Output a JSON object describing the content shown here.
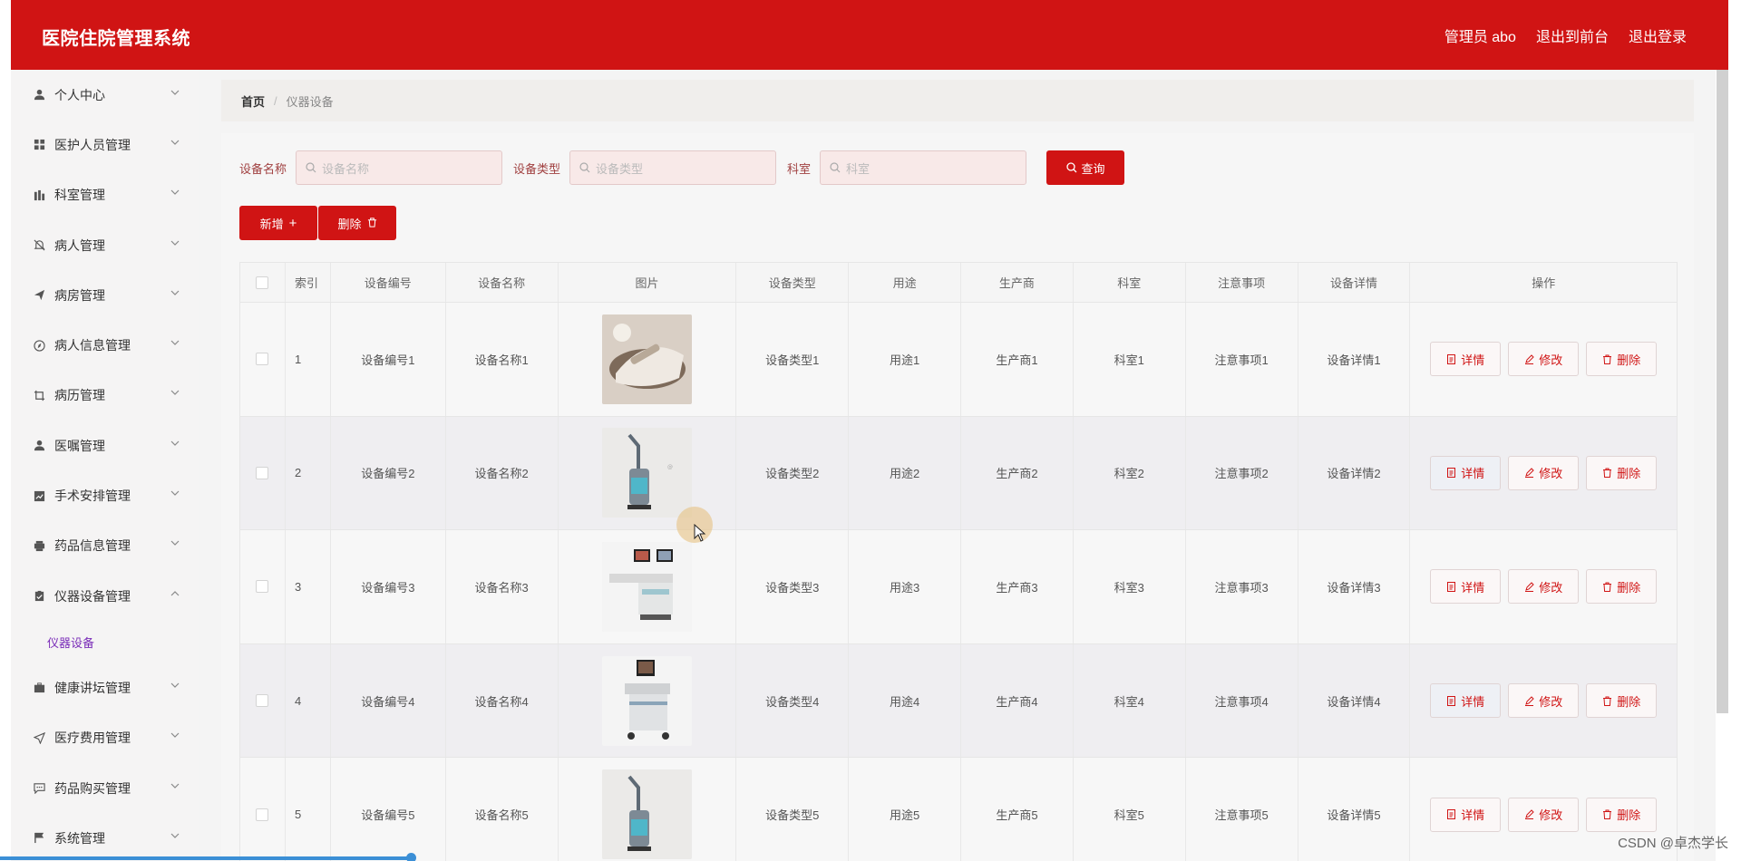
{
  "header": {
    "title": "医院住院管理系统",
    "admin": "管理员 abo",
    "to_front": "退出到前台",
    "logout": "退出登录"
  },
  "sidebar": {
    "items": [
      {
        "label": "个人中心",
        "icon": "user-icon"
      },
      {
        "label": "医护人员管理",
        "icon": "grid-icon"
      },
      {
        "label": "科室管理",
        "icon": "bars-icon"
      },
      {
        "label": "病人管理",
        "icon": "bell-off-icon"
      },
      {
        "label": "病房管理",
        "icon": "send-icon"
      },
      {
        "label": "病人信息管理",
        "icon": "compass-icon"
      },
      {
        "label": "病历管理",
        "icon": "crop-icon"
      },
      {
        "label": "医嘱管理",
        "icon": "user-icon"
      },
      {
        "label": "手术安排管理",
        "icon": "chart-icon"
      },
      {
        "label": "药品信息管理",
        "icon": "printer-icon"
      },
      {
        "label": "仪器设备管理",
        "icon": "clipboard-icon"
      },
      {
        "label": "健康讲坛管理",
        "icon": "briefcase-icon"
      },
      {
        "label": "医疗费用管理",
        "icon": "navigate-icon"
      },
      {
        "label": "药品购买管理",
        "icon": "message-icon"
      },
      {
        "label": "系统管理",
        "icon": "flag-icon"
      }
    ],
    "sub_item": "仪器设备"
  },
  "breadcrumb": {
    "home": "首页",
    "sep": "/",
    "current": "仪器设备"
  },
  "search": {
    "name_label": "设备名称",
    "name_placeholder": "设备名称",
    "type_label": "设备类型",
    "type_placeholder": "设备类型",
    "dept_label": "科室",
    "dept_placeholder": "科室",
    "query_label": "查询"
  },
  "actions": {
    "add_label": "新增",
    "delete_label": "删除"
  },
  "table": {
    "headers": [
      "索引",
      "设备编号",
      "设备名称",
      "图片",
      "设备类型",
      "用途",
      "生产商",
      "科室",
      "注意事项",
      "设备详情",
      "操作"
    ],
    "rows": [
      {
        "idx": "1",
        "no": "设备编号1",
        "name": "设备名称1",
        "type": "设备类型1",
        "use": "用途1",
        "mfr": "生产商1",
        "dept": "科室1",
        "note": "注意事项1",
        "detail": "设备详情1"
      },
      {
        "idx": "2",
        "no": "设备编号2",
        "name": "设备名称2",
        "type": "设备类型2",
        "use": "用途2",
        "mfr": "生产商2",
        "dept": "科室2",
        "note": "注意事项2",
        "detail": "设备详情2"
      },
      {
        "idx": "3",
        "no": "设备编号3",
        "name": "设备名称3",
        "type": "设备类型3",
        "use": "用途3",
        "mfr": "生产商3",
        "dept": "科室3",
        "note": "注意事项3",
        "detail": "设备详情3"
      },
      {
        "idx": "4",
        "no": "设备编号4",
        "name": "设备名称4",
        "type": "设备类型4",
        "use": "用途4",
        "mfr": "生产商4",
        "dept": "科室4",
        "note": "注意事项4",
        "detail": "设备详情4"
      },
      {
        "idx": "5",
        "no": "设备编号5",
        "name": "设备名称5",
        "type": "设备类型5",
        "use": "用途5",
        "mfr": "生产商5",
        "dept": "科室5",
        "note": "注意事项5",
        "detail": "设备详情5"
      }
    ],
    "op_detail": "详情",
    "op_edit": "修改",
    "op_delete": "删除"
  },
  "watermark": "CSDN @卓杰学长",
  "colors": {
    "brand": "#d01414",
    "sub_item": "#7a2cb8"
  }
}
